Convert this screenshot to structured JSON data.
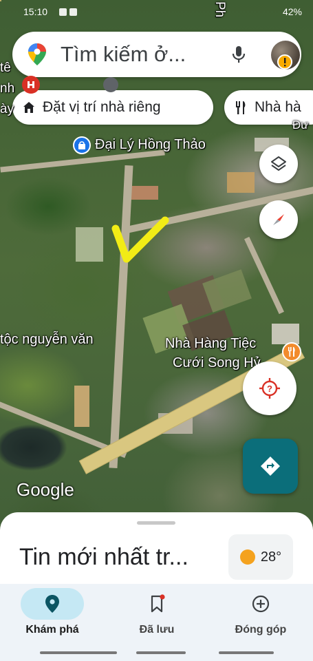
{
  "status_bar": {
    "time": "15:10",
    "battery": "42%"
  },
  "search": {
    "placeholder": "Tìm kiếm ở..."
  },
  "chips": [
    {
      "label": "Đặt vị trí nhà riêng",
      "icon": "home-icon"
    },
    {
      "label": "Nhà hà",
      "icon": "restaurant-icon"
    }
  ],
  "map": {
    "labels": {
      "dai_ly": "Đại Lý Hồng Thảo",
      "nguyen_van": "tộc nguyễn văn",
      "nha_hang_line1": "Nhà Hàng Tiệc",
      "nha_hang_line2": "Cưới Song Hỷ",
      "left_top_1": "tê",
      "left_top_2": "nh",
      "left_top_3": "ày",
      "road_side": "Ph",
      "right_edge": "Đư"
    },
    "attribution": "Google"
  },
  "bottom_sheet": {
    "title": "Tin mới nhất tr...",
    "weather": {
      "temp": "28°",
      "icon": "sun-icon"
    }
  },
  "nav": [
    {
      "label": "Khám phá",
      "icon": "explore-pin-icon",
      "active": true
    },
    {
      "label": "Đã lưu",
      "icon": "bookmark-icon",
      "active": false
    },
    {
      "label": "Đóng góp",
      "icon": "add-circle-icon",
      "active": false
    }
  ],
  "colors": {
    "accent": "#0b6e7a",
    "nav_active": "#c5e8f4",
    "poi_blue": "#1a73e8",
    "poi_orange": "#f28b2c",
    "poi_red": "#d93025"
  }
}
